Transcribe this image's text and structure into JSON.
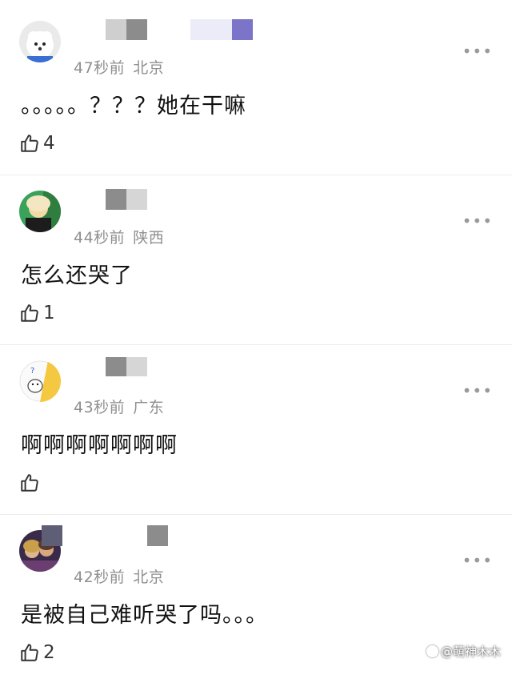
{
  "comments": [
    {
      "time": "47秒前",
      "location": "北京",
      "text": "。。。。。？？？她在干嘛",
      "likes": "4",
      "avatar_icon": "white-dog-avatar"
    },
    {
      "time": "44秒前",
      "location": "陕西",
      "text": "怎么还哭了",
      "likes": "1",
      "avatar_icon": "blonde-person-avatar"
    },
    {
      "time": "43秒前",
      "location": "广东",
      "text": "啊啊啊啊啊啊啊",
      "likes": "",
      "avatar_icon": "cartoon-bear-avatar"
    },
    {
      "time": "42秒前",
      "location": "北京",
      "text": "是被自己难听哭了吗。。。",
      "likes": "2",
      "avatar_icon": "group-photo-avatar"
    }
  ],
  "more_label": "•••",
  "watermark": "@萌神木木",
  "colors": {
    "meta": "#8f8f8f",
    "divider": "#ececec",
    "mosaic_dark": "#8c8c8c",
    "mosaic_light": "#d6d6d6",
    "mosaic_purple": "#7b74c9"
  }
}
